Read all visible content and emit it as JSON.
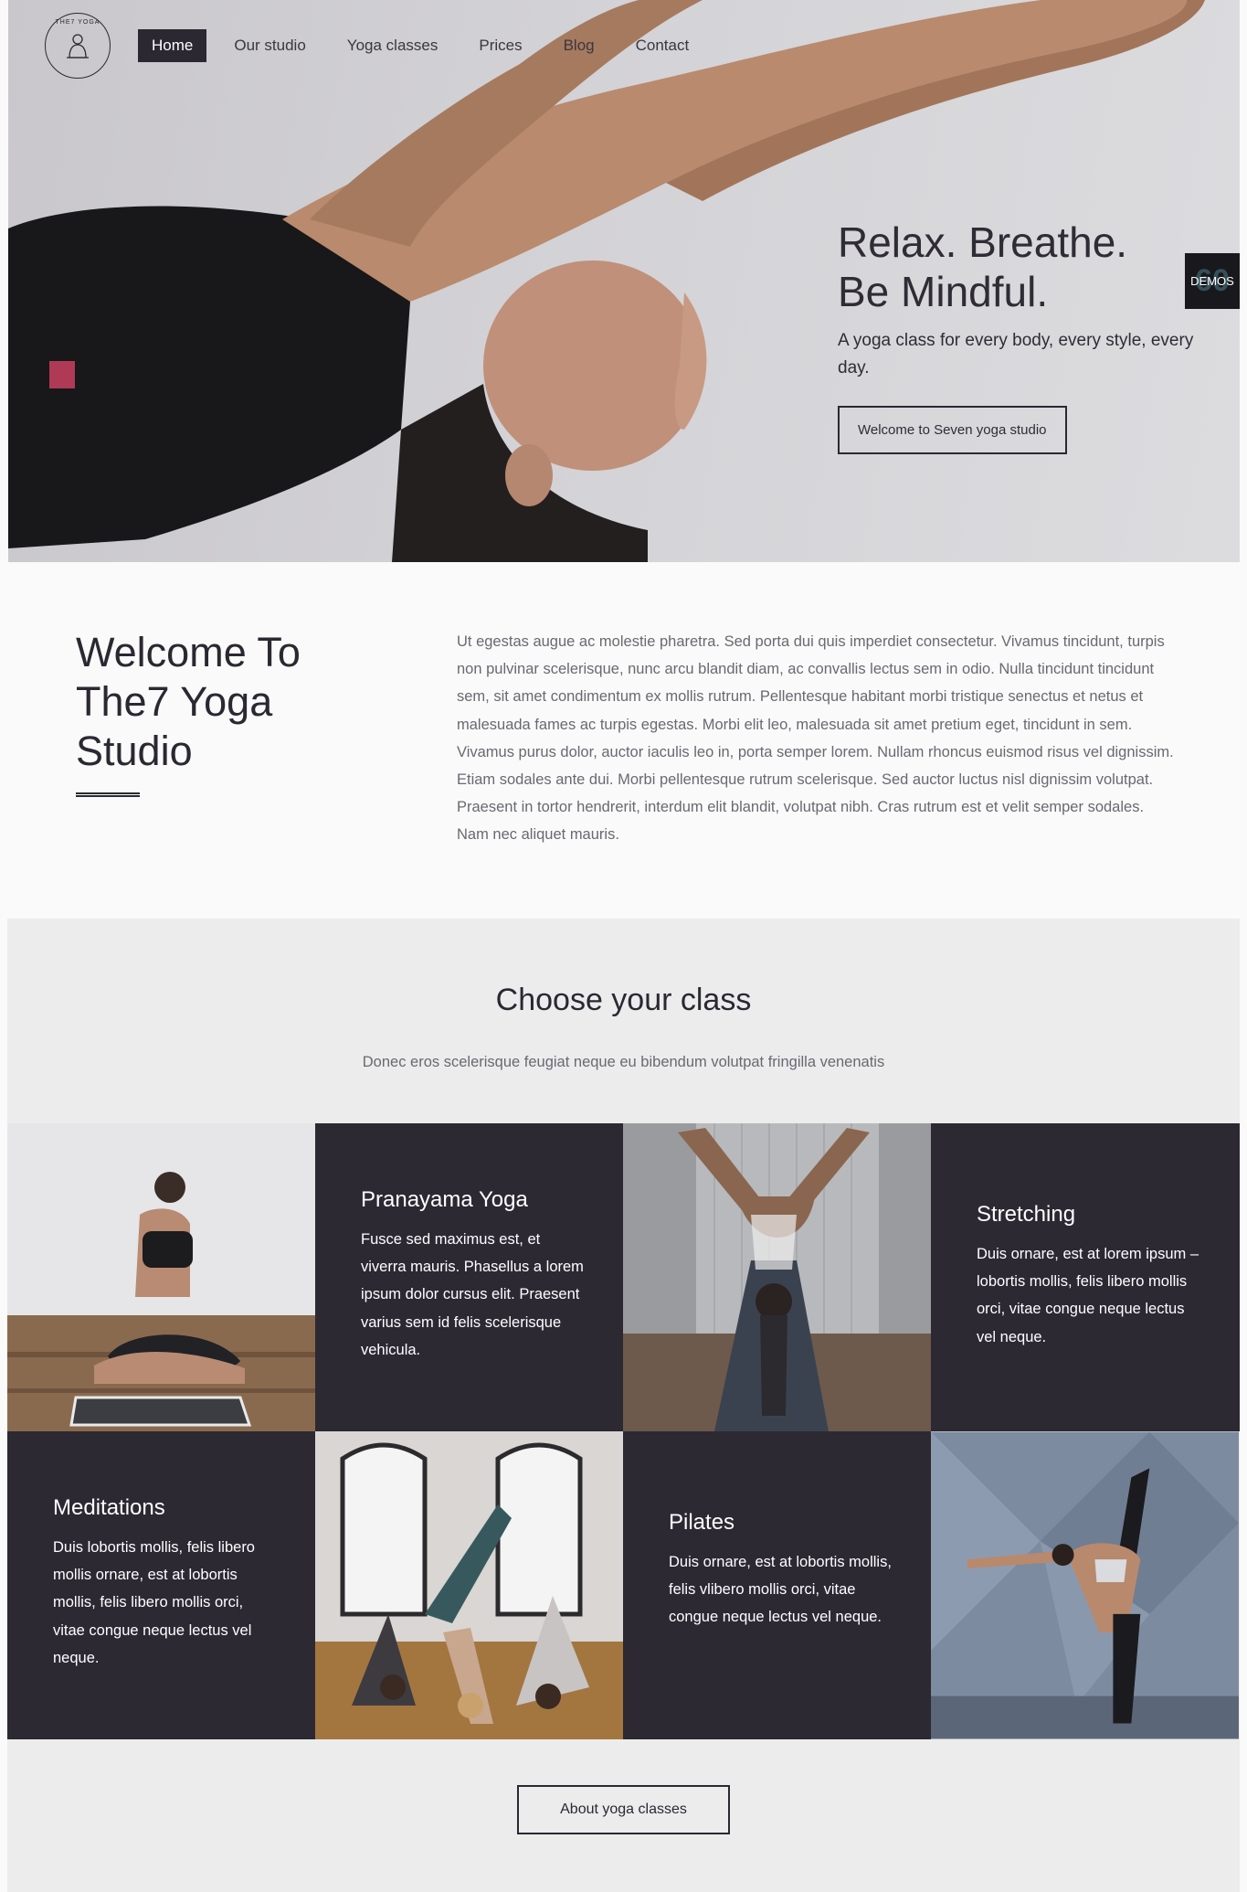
{
  "nav": {
    "logo_text": "THE7 YOGA",
    "items": [
      {
        "label": "Home",
        "active": true
      },
      {
        "label": "Our studio"
      },
      {
        "label": "Yoga classes"
      },
      {
        "label": "Prices"
      },
      {
        "label": "Blog"
      },
      {
        "label": "Contact"
      }
    ]
  },
  "hero": {
    "title_line1": "Relax. Breathe.",
    "title_line2": "Be Mindful.",
    "subtitle": "A yoga class for every body, every style, every day.",
    "button": "Welcome to Seven yoga studio"
  },
  "demos": {
    "label": "DEMOS",
    "badge": "60"
  },
  "welcome": {
    "title": "Welcome To The7 Yoga Studio",
    "text": "Ut egestas augue ac molestie pharetra. Sed porta dui quis imperdiet consectetur. Vivamus tincidunt, turpis non pulvinar scelerisque, nunc arcu blandit diam, ac convallis lectus sem in odio. Nulla tincidunt tincidunt sem, sit amet condimentum ex mollis rutrum. Pellentesque habitant morbi tristique senectus et netus et malesuada fames ac turpis egestas. Morbi elit leo, malesuada sit amet pretium eget, tincidunt in sem. Vivamus purus dolor, auctor iaculis leo in, porta semper lorem. Nullam rhoncus euismod risus vel dignissim. Etiam sodales ante dui. Morbi pellentesque rutrum scelerisque. Sed auctor luctus nisl dignissim volutpat. Praesent in tortor hendrerit, interdum elit blandit, volutpat nibh. Cras rutrum est et velit semper sodales. Nam nec aliquet mauris."
  },
  "classes": {
    "title": "Choose your class",
    "subtitle": "Donec eros scelerisque feugiat neque eu bibendum volutpat fringilla venenatis",
    "items": [
      {
        "title": "Pranayama Yoga",
        "text": "Fusce sed maximus est, et viverra mauris. Phasellus a lorem ipsum dolor cursus elit. Praesent varius sem id felis scelerisque vehicula."
      },
      {
        "title": "Stretching",
        "text": "Duis ornare, est at lorem ipsum – lobortis mollis, felis libero mollis orci, vitae congue neque lectus vel neque."
      },
      {
        "title": "Meditations",
        "text": "Duis lobortis mollis, felis libero mollis ornare, est at lobortis mollis, felis libero mollis orci, vitae congue neque lectus vel neque."
      },
      {
        "title": "Pilates",
        "text": "Duis ornare, est at lobortis mollis, felis vlibero mollis orci, vitae congue neque lectus vel neque."
      }
    ],
    "button": "About yoga classes"
  },
  "colors": {
    "dark": "#2c2933",
    "light_bg": "#fafafa",
    "section_bg": "#ececec"
  }
}
